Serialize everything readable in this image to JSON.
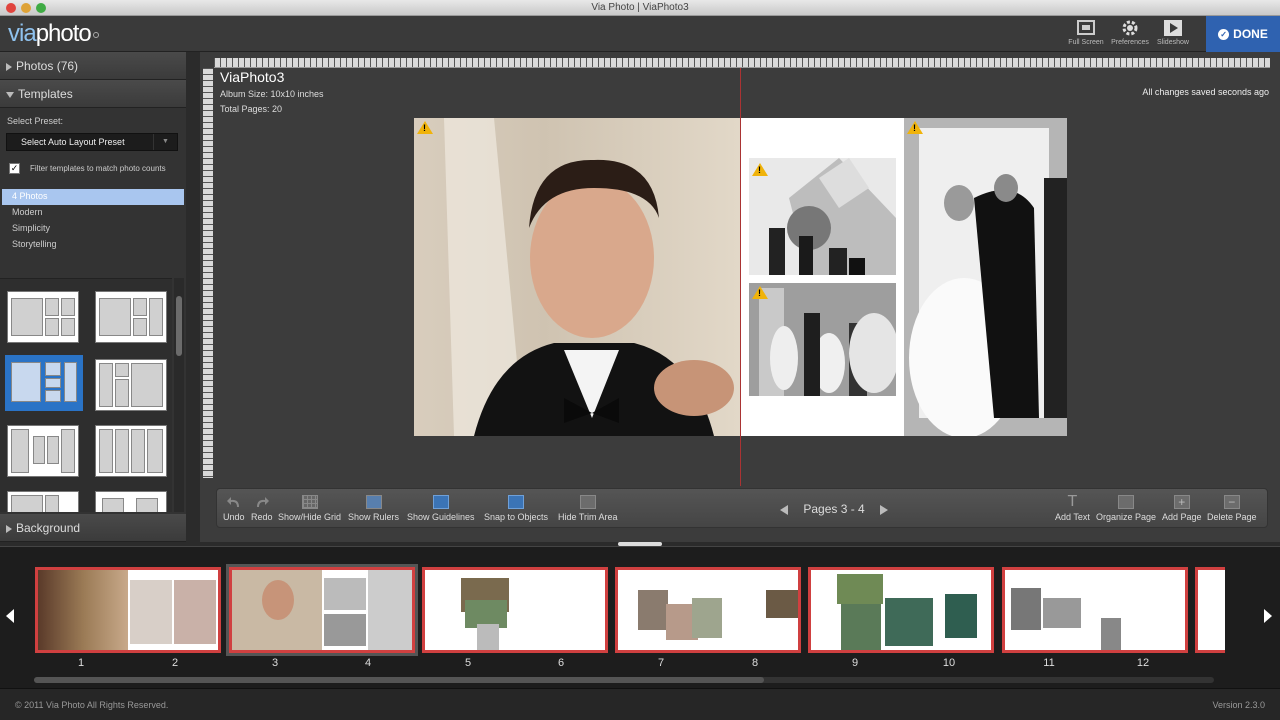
{
  "window": {
    "title": "Via Photo | ViaPhoto3"
  },
  "app": {
    "logo_text_a": "via",
    "logo_text_b": "photo",
    "toolbar": {
      "full_screen": "Full Screen",
      "preferences": "Preferences",
      "slideshow": "Slideshow",
      "done": "DONE"
    }
  },
  "sidebar": {
    "photos_header": "Photos (76)",
    "templates_header": "Templates",
    "select_preset_label": "Select Preset:",
    "preset_value": "Select Auto Layout Preset",
    "filter_label": "Filter templates to match photo counts",
    "filter_checked": true,
    "template_categories": [
      "4 Photos",
      "Modern",
      "Simplicity",
      "Storytelling"
    ],
    "selected_category": "4 Photos",
    "background_header": "Background"
  },
  "album": {
    "name": "ViaPhoto3",
    "size": "Album Size: 10x10 inches",
    "total_pages": "Total Pages: 20",
    "save_status": "All changes saved seconds ago"
  },
  "bottom_toolbar": {
    "undo": "Undo",
    "redo": "Redo",
    "grid": "Show/Hide Grid",
    "rulers": "Show Rulers",
    "guidelines": "Show Guidelines",
    "snap": "Snap to Objects",
    "trim": "Hide Trim Area",
    "pages_label": "Pages 3 - 4",
    "add_text": "Add Text",
    "organize": "Organize Page",
    "add_page": "Add Page",
    "delete_page": "Delete Page"
  },
  "filmstrip": {
    "page_numbers": [
      "1",
      "2",
      "3",
      "4",
      "5",
      "6",
      "7",
      "8",
      "9",
      "10",
      "11",
      "12"
    ]
  },
  "footer": {
    "copyright": "© 2011 Via Photo All Rights Reserved.",
    "version": "Version 2.3.0"
  },
  "colors": {
    "accent": "#2f62b0",
    "warning": "#f0b30a",
    "spread_border": "#d04040"
  }
}
